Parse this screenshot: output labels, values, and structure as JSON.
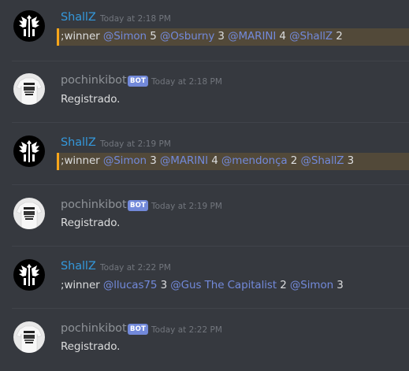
{
  "colors": {
    "background": "#36393f",
    "username_shallz": "#3498db",
    "username_bot": "#8e9297",
    "mention": "#7289da",
    "bot_badge": "#7289da",
    "highlight_bar": "#faa61a"
  },
  "messages": [
    {
      "author": "ShallZ",
      "timestamp": "Today at 2:18 PM",
      "highlighted": true,
      "parts": [
        ";winner ",
        "@Simon",
        " 5 ",
        "@Osburny",
        " 3 ",
        "@MARINI",
        " 4 ",
        "@ShallZ",
        " 2"
      ]
    },
    {
      "author": "pochinkibot",
      "badge": "BOT",
      "timestamp": "Today at 2:18 PM",
      "text": "Registrado."
    },
    {
      "author": "ShallZ",
      "timestamp": "Today at 2:19 PM",
      "highlighted": true,
      "parts": [
        ";winner ",
        "@Simon",
        " 3 ",
        "@MARINI",
        " 4 ",
        "@mendonça",
        " 2 ",
        "@ShallZ",
        " 3"
      ]
    },
    {
      "author": "pochinkibot",
      "badge": "BOT",
      "timestamp": "Today at 2:19 PM",
      "text": "Registrado."
    },
    {
      "author": "ShallZ",
      "timestamp": "Today at 2:22 PM",
      "highlighted": false,
      "parts": [
        ";winner ",
        "@llucas75",
        " 3 ",
        "@Gus The Capitalist",
        " 2 ",
        "@Simon",
        " 3"
      ]
    },
    {
      "author": "pochinkibot",
      "badge": "BOT",
      "timestamp": "Today at 2:22 PM",
      "text": "Registrado."
    }
  ]
}
